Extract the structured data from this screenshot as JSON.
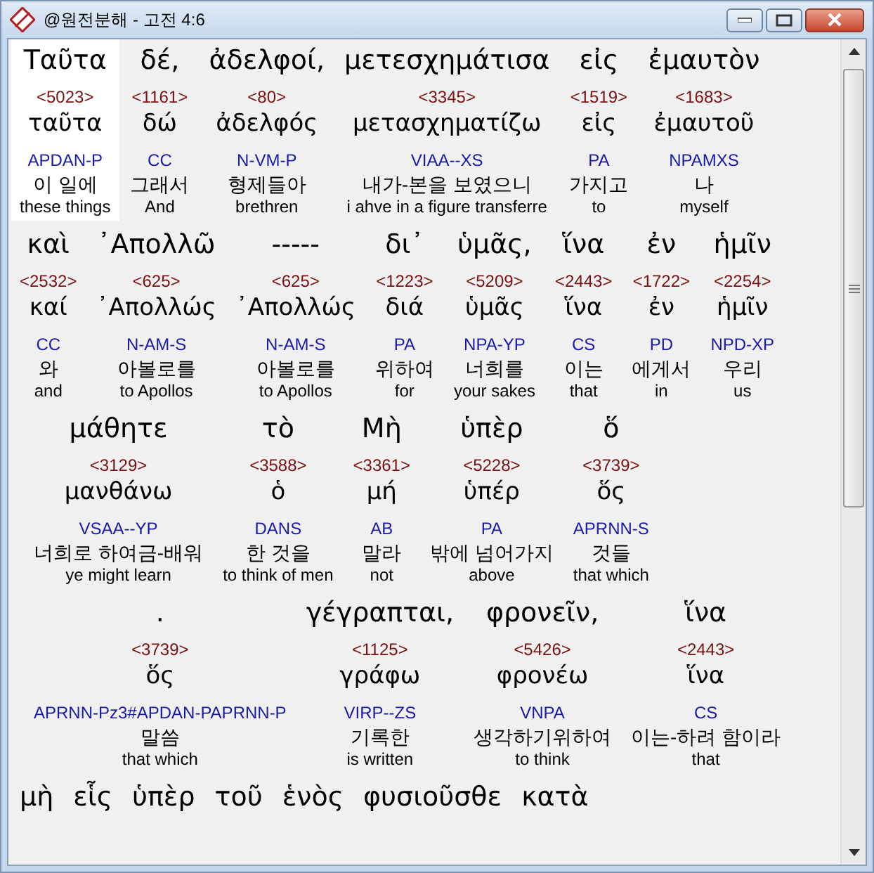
{
  "window": {
    "title": "@원전분해 - 고전 4:6"
  },
  "rows": [
    {
      "words": [
        {
          "greek": "Ταῦτα",
          "strong": "<5023>",
          "lemma": "ταῦτα",
          "parsing": "APDAN-P",
          "korean": "이 일에",
          "english": "these things",
          "selected": true
        },
        {
          "greek": "δέ,",
          "strong": "<1161>",
          "lemma": "δώ",
          "parsing": "CC",
          "korean": "그래서",
          "english": "And",
          "selected": false
        },
        {
          "greek": "ἀδελφοί,",
          "strong": "<80>",
          "lemma": "ἀδελφός",
          "parsing": "N-VM-P",
          "korean": "형제들아",
          "english": "brethren",
          "selected": false
        },
        {
          "greek": "μετεσχημάτισα",
          "strong": "<3345>",
          "lemma": "μετασχηματίζω",
          "parsing": "VIAA--XS",
          "korean": "내가-본을 보였으니",
          "english": "i ahve in a figure transferre",
          "selected": false
        },
        {
          "greek": "εἰς",
          "strong": "<1519>",
          "lemma": "εἰς",
          "parsing": "PA",
          "korean": "가지고",
          "english": "to",
          "selected": false
        },
        {
          "greek": "ἐμαυτὸν",
          "strong": "<1683>",
          "lemma": "ἐμαυτοῦ",
          "parsing": "NPAMXS",
          "korean": "나",
          "english": "myself",
          "selected": false
        }
      ]
    },
    {
      "words": [
        {
          "greek": "καὶ",
          "strong": "<2532>",
          "lemma": "καί",
          "parsing": "CC",
          "korean": "와",
          "english": "and",
          "selected": false
        },
        {
          "greek": "᾿Απολλῶ",
          "strong": "<625>",
          "lemma": "᾿Απολλώς",
          "parsing": "N-AM-S",
          "korean": "아볼로를",
          "english": "to Apollos",
          "selected": false
        },
        {
          "greek": "-----",
          "strong": "<625>",
          "lemma": "᾿Απολλώς",
          "parsing": "N-AM-S",
          "korean": "아볼로를",
          "english": "to Apollos",
          "selected": false
        },
        {
          "greek": "δι᾿",
          "strong": "<1223>",
          "lemma": "διά",
          "parsing": "PA",
          "korean": "위하여",
          "english": "for",
          "selected": false
        },
        {
          "greek": "ὑμᾶς,",
          "strong": "<5209>",
          "lemma": "ὑμᾶς",
          "parsing": "NPA-YP",
          "korean": "너희를",
          "english": "your sakes",
          "selected": false
        },
        {
          "greek": "ἵνα",
          "strong": "<2443>",
          "lemma": "ἵνα",
          "parsing": "CS",
          "korean": "이는",
          "english": "that",
          "selected": false
        },
        {
          "greek": "ἐν",
          "strong": "<1722>",
          "lemma": "ἐν",
          "parsing": "PD",
          "korean": "에게서",
          "english": "in",
          "selected": false
        },
        {
          "greek": "ἡμῖν",
          "strong": "<2254>",
          "lemma": "ἡμῖν",
          "parsing": "NPD-XP",
          "korean": "우리",
          "english": "us",
          "selected": false
        }
      ]
    },
    {
      "words": [
        {
          "greek": "μάθητε",
          "strong": "<3129>",
          "lemma": "μανθάνω",
          "parsing": "VSAA--YP",
          "korean": "너희로 하여금-배워",
          "english": "ye might learn",
          "selected": false
        },
        {
          "greek": "τὸ",
          "strong": "<3588>",
          "lemma": "ὁ",
          "parsing": "DANS",
          "korean": "한 것을",
          "english": "to think of men",
          "selected": false
        },
        {
          "greek": "Μὴ",
          "strong": "<3361>",
          "lemma": "μή",
          "parsing": "AB",
          "korean": "말라",
          "english": "not",
          "selected": false
        },
        {
          "greek": "ὑπὲρ",
          "strong": "<5228>",
          "lemma": "ὑπέρ",
          "parsing": "PA",
          "korean": "밖에 넘어가지",
          "english": "above",
          "selected": false
        },
        {
          "greek": "ὅ",
          "strong": "<3739>",
          "lemma": "ὅς",
          "parsing": "APRNN-S",
          "korean": "것들",
          "english": "that which",
          "selected": false
        }
      ]
    },
    {
      "words": [
        {
          "greek": ".",
          "strong": "<3739>",
          "lemma": "ὅς",
          "parsing": "APRNN-Pz3#APDAN-PAPRNN-P",
          "korean": "말씀",
          "english": "that which",
          "selected": false
        },
        {
          "greek": "γέγραπται,",
          "strong": "<1125>",
          "lemma": "γράφω",
          "parsing": "VIRP--ZS",
          "korean": "기록한",
          "english": "is written",
          "selected": false
        },
        {
          "greek": "φρονεῖν,",
          "strong": "<5426>",
          "lemma": "φρονέω",
          "parsing": "VNPA",
          "korean": "생각하기위하여",
          "english": "to think",
          "selected": false
        },
        {
          "greek": "ἵνα",
          "strong": "<2443>",
          "lemma": "ἵνα",
          "parsing": "CS",
          "korean": "이는-하려 함이라",
          "english": "that",
          "selected": false
        }
      ]
    },
    {
      "words": [
        {
          "greek": "μὴ",
          "selected": false
        },
        {
          "greek": "εἷς",
          "selected": false
        },
        {
          "greek": "ὑπὲρ",
          "selected": false
        },
        {
          "greek": "τοῦ",
          "selected": false
        },
        {
          "greek": "ἑνὸς",
          "selected": false
        },
        {
          "greek": "φυσιοῦσθε",
          "selected": false
        },
        {
          "greek": "κατὰ",
          "selected": false
        }
      ]
    }
  ]
}
